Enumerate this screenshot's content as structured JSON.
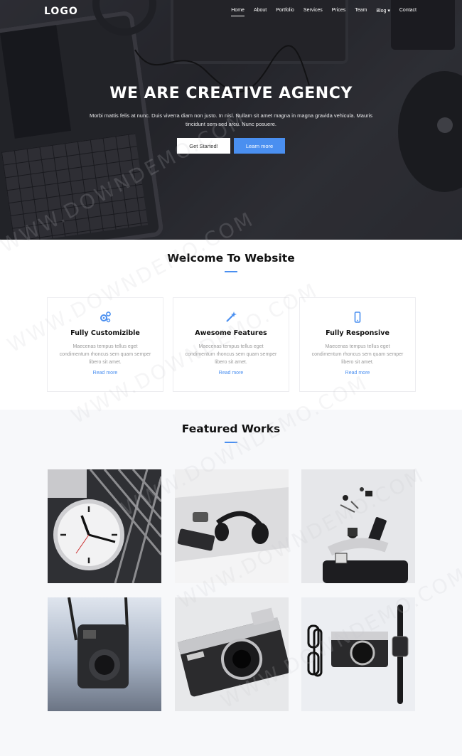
{
  "nav": {
    "logo": "LOGO",
    "items": [
      {
        "label": "Home",
        "active": true
      },
      {
        "label": "About"
      },
      {
        "label": "Portfolio"
      },
      {
        "label": "Services"
      },
      {
        "label": "Prices"
      },
      {
        "label": "Team"
      },
      {
        "label": "Blog",
        "dropdown": true
      },
      {
        "label": "Contact"
      }
    ]
  },
  "hero": {
    "title": "WE ARE CREATIVE AGENCY",
    "subtitle": "Morbi mattis felis at nunc. Duis viverra diam non justo. In nisl. Nullam sit amet magna in magna gravida vehicula. Mauris tincidunt sem sed arcu. Nunc posuere.",
    "primary_button": "Get Started!",
    "secondary_button": "Learn more"
  },
  "welcome": {
    "title": "Welcome To Website",
    "cards": [
      {
        "icon": "gears-icon",
        "title": "Fully Customizible",
        "text": "Maecenas tempus tellus eget condimentum rhoncus sem quam semper libero sit amet.",
        "link": "Read more"
      },
      {
        "icon": "magic-wand-icon",
        "title": "Awesome Features",
        "text": "Maecenas tempus tellus eget condimentum rhoncus sem quam semper libero sit amet.",
        "link": "Read more"
      },
      {
        "icon": "mobile-phone-icon",
        "title": "Fully Responsive",
        "text": "Maecenas tempus tellus eget condimentum rhoncus sem quam semper libero sit amet.",
        "link": "Read more"
      }
    ]
  },
  "featured": {
    "title": "Featured Works",
    "items": [
      {
        "name": "clock-photo"
      },
      {
        "name": "headphones-desk-photo"
      },
      {
        "name": "flatlay-accessories-photo"
      },
      {
        "name": "instant-camera-photo"
      },
      {
        "name": "film-camera-photo"
      },
      {
        "name": "camera-glasses-watch-photo"
      }
    ]
  },
  "watermark": "WWW.DOWNDEMO.COM",
  "colors": {
    "accent": "#4a8ff0",
    "hero_overlay": "#2e2f35",
    "section_bg": "#f7f8fa"
  }
}
